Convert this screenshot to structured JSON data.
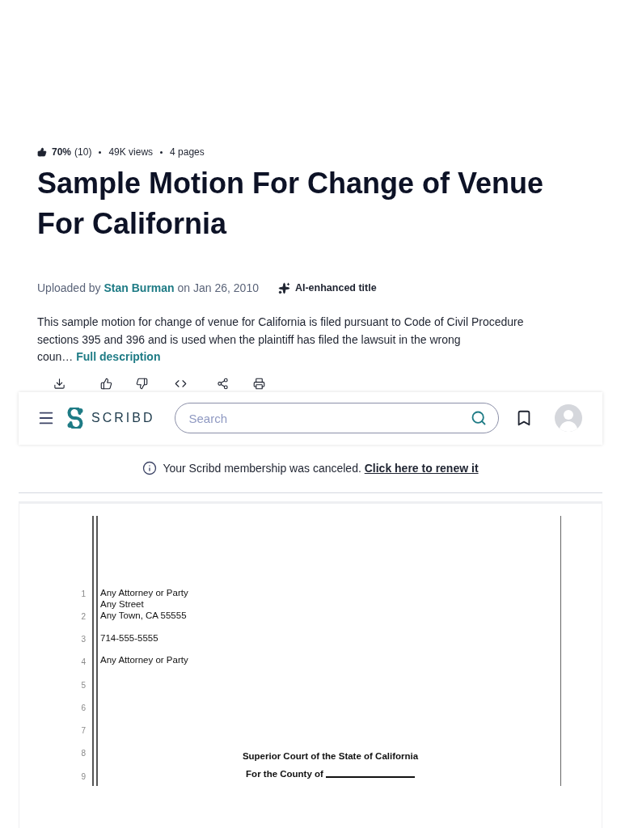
{
  "stats": {
    "rating": "70%",
    "rating_count": "(10)",
    "views": "49K views",
    "pages": "4 pages"
  },
  "title": "Sample Motion For Change of Venue For California",
  "upload": {
    "prefix": "Uploaded by",
    "author": "Stan Burman",
    "date_text": "on Jan 26, 2010",
    "badge": "AI-enhanced title"
  },
  "description": {
    "lines": [
      "This sample motion for change of venue for California is filed pursuant to Code of Civil Procedure",
      "sections 395 and 396 and is used when the plaintiff has filed the lawsuit in the wrong",
      "coun…"
    ],
    "more_link": "Full description"
  },
  "header": {
    "logo_text": "SCRIBD",
    "search": {
      "placeholder": "Search"
    }
  },
  "banner": {
    "message": "Your Scribd membership was canceled.",
    "link": "Click here to renew it"
  },
  "document": {
    "line_numbers": [
      "1",
      "2",
      "3",
      "4",
      "5",
      "6",
      "7",
      "8",
      "9"
    ],
    "address": [
      "Any Attorney or Party",
      "Any Street",
      "Any Town, CA 55555"
    ],
    "phone": "714-555-5555",
    "party": "Any Attorney or Party",
    "court": "Superior Court of the State of California",
    "county_label": "For the County of"
  }
}
